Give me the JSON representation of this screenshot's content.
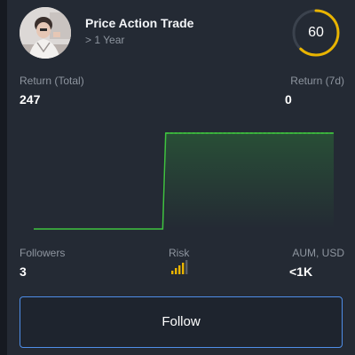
{
  "header": {
    "trader_name": "Price Action Trade",
    "tenure": "> 1 Year",
    "score": "60",
    "score_fraction": 0.62
  },
  "stats": {
    "return_total_label": "Return (Total)",
    "return_total_value": "247",
    "return_7d_label": "Return (7d)",
    "return_7d_value": "0",
    "followers_label": "Followers",
    "followers_value": "3",
    "risk_label": "Risk",
    "risk_level": 4,
    "risk_max": 5,
    "aum_label": "AUM, USD",
    "aum_value": "<1K"
  },
  "chart_data": {
    "type": "area",
    "x": [
      0,
      1,
      2,
      3
    ],
    "values": [
      0,
      0,
      247,
      247
    ]
  },
  "actions": {
    "follow_label": "Follow"
  },
  "colors": {
    "accent": "#e9b400",
    "line": "#3fc33f",
    "button_border": "#4f8ee8"
  },
  "icons": {
    "avatar": "user-photo",
    "risk": "signal-bars-icon"
  }
}
